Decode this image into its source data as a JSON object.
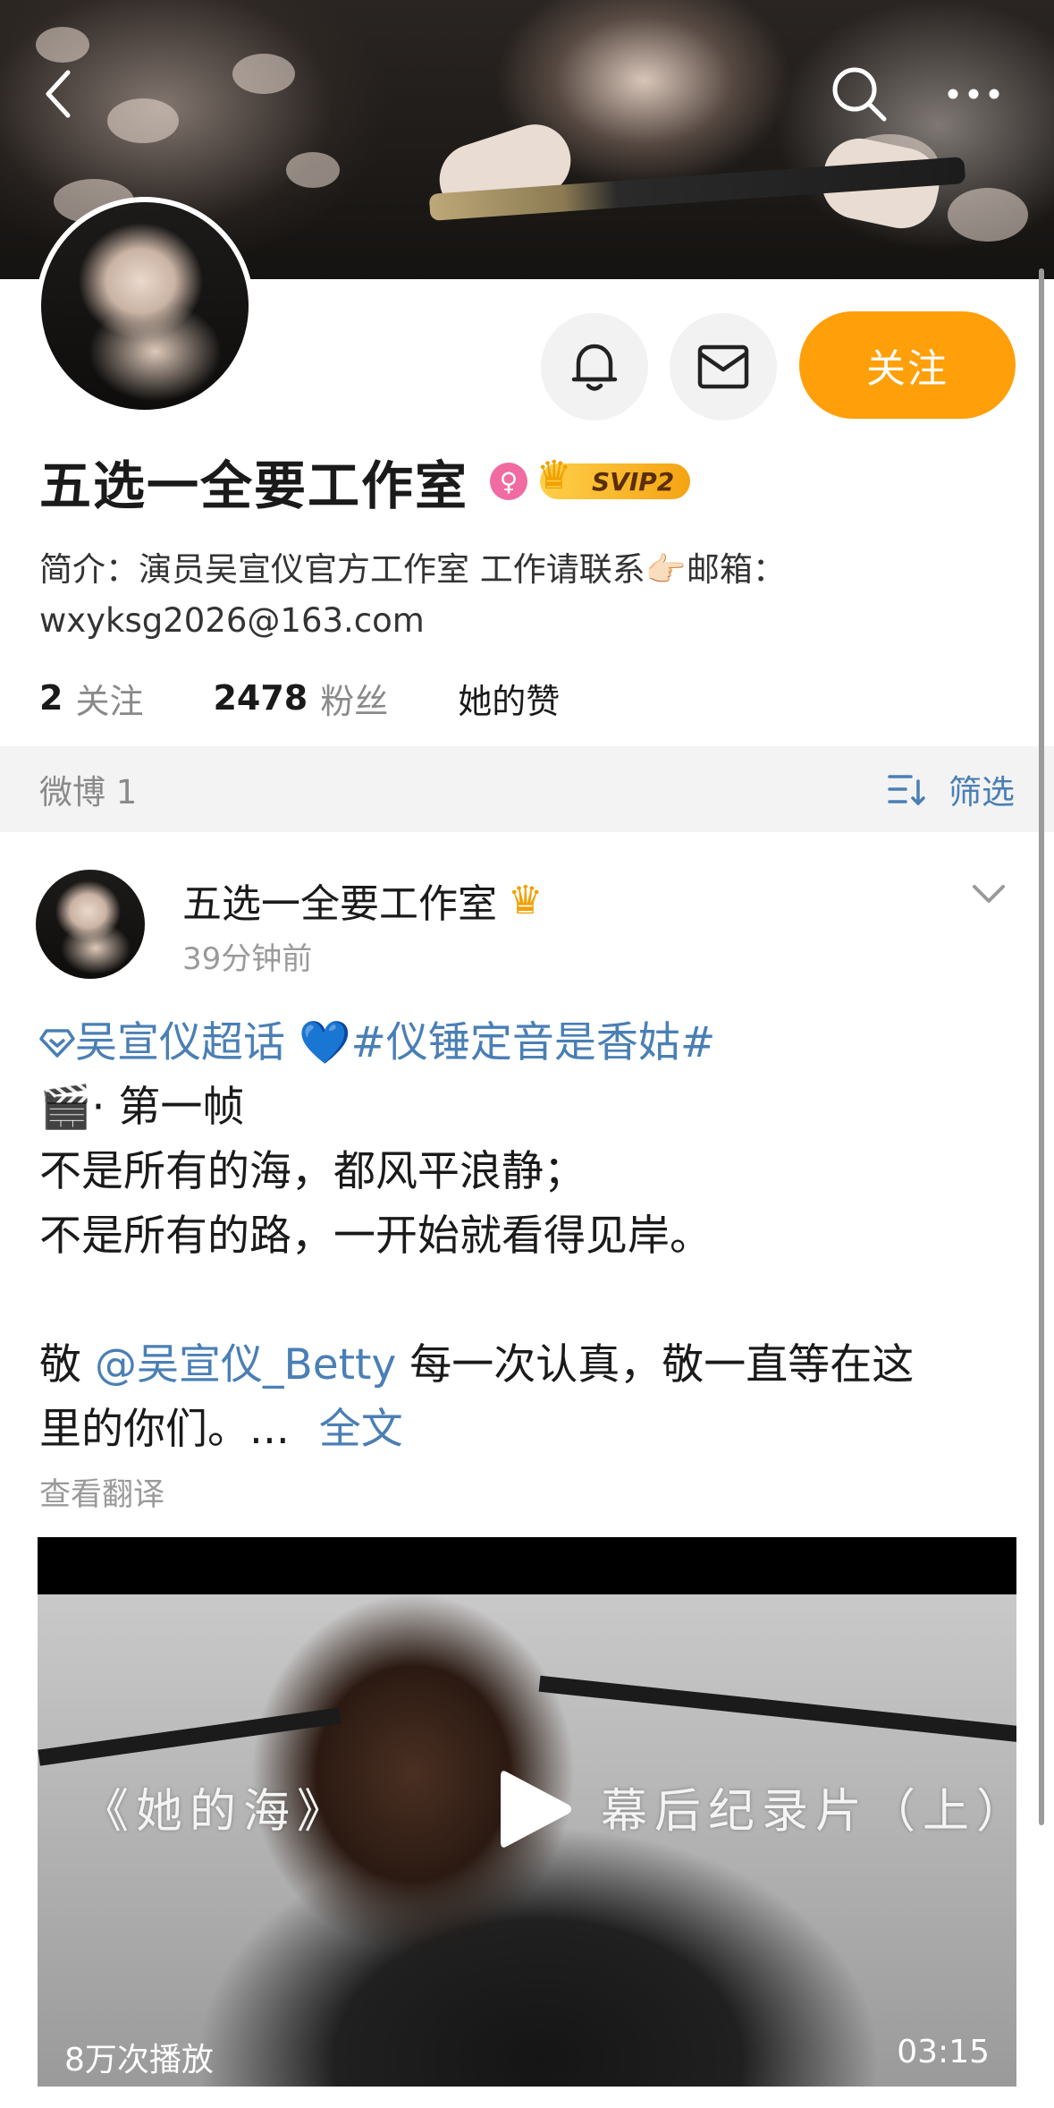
{
  "profile": {
    "name": "五选一全要工作室",
    "svip_label": "SVIP2",
    "follow_label": "关注",
    "bio_line1": "简介：演员吴宣仪官方工作室 工作请联系👉🏻邮箱：",
    "bio_line2": "wxyksg2026@163.com",
    "following_count": "2",
    "following_label": "关注",
    "followers_count": "2478",
    "followers_label": "粉丝",
    "likes_label": "她的赞"
  },
  "tabbar": {
    "weibo_label": "微博 1",
    "filter_label": "筛选"
  },
  "post": {
    "author": "五选一全要工作室",
    "time": "39分钟前",
    "supertopic": "吴宣仪超话",
    "heart": "💙",
    "hashtag": "#仪锤定音是香姑#",
    "clapper": "🎬",
    "line2": "· 第一帧",
    "line3": "不是所有的海，都风平浪静；",
    "line4": "不是所有的路，一开始就看得见岸。",
    "line5_prefix": "敬",
    "mention": "@吴宣仪_Betty",
    "line5_suffix": "每一次认真，敬一直等在这",
    "line6": "里的你们。...",
    "full_text_link": "全文",
    "translate": "查看翻译"
  },
  "video": {
    "caption_left": "《她的海》",
    "caption_right": "幕后纪录片（上）",
    "views": "8万次播放",
    "duration": "03:15"
  },
  "icons": {
    "back": "back-chevron-icon",
    "search": "search-icon",
    "more": "more-dots-icon",
    "bell": "bell-icon",
    "message": "message-icon",
    "female": "female-icon",
    "crown": "crown-icon",
    "filter": "filter-icon",
    "chevron": "chevron-down-icon",
    "play": "play-icon",
    "supertopic": "diamond-icon"
  },
  "colors": {
    "accent_orange": "#ff9f0a",
    "link_blue": "#4a7fb5",
    "female_pink": "#f06ba2"
  }
}
